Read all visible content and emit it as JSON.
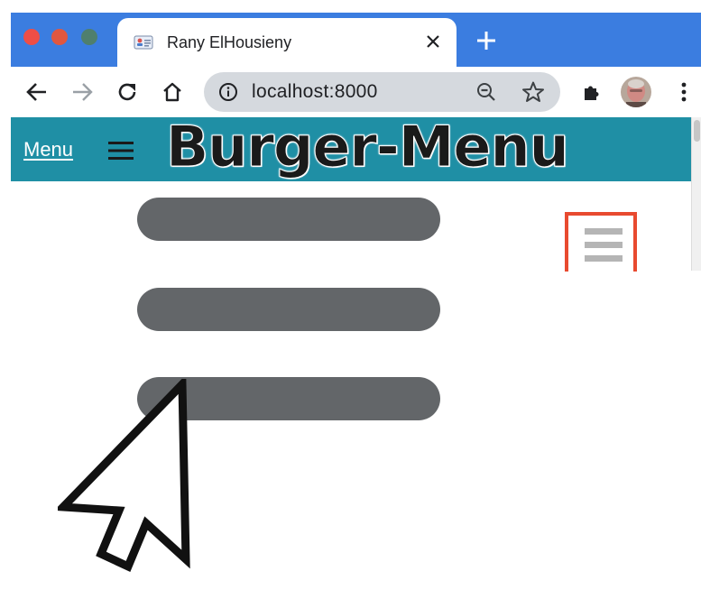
{
  "browser": {
    "tab": {
      "title": "Rany ElHousieny"
    },
    "address_bar": {
      "url": "localhost:8000"
    },
    "window_controls": [
      "close",
      "minimize",
      "maximize"
    ],
    "toolbar_icons": [
      "back-icon",
      "forward-icon",
      "reload-icon",
      "home-icon",
      "info-icon",
      "zoom-out-icon",
      "bookmark-star-icon",
      "extensions-icon",
      "profile-avatar",
      "more-menu-icon"
    ],
    "colors": {
      "tab_strip": "#3b7de0",
      "omnibox": "#d5d9de"
    }
  },
  "page": {
    "header": {
      "menu_link": "Menu",
      "title": "Burger-Menu",
      "background": "#1f8fa5"
    },
    "illustration": {
      "bar_color": "#636669",
      "highlight_border": "#e84a2f",
      "icons": [
        "hamburger-icon",
        "mouse-pointer-icon"
      ]
    }
  }
}
